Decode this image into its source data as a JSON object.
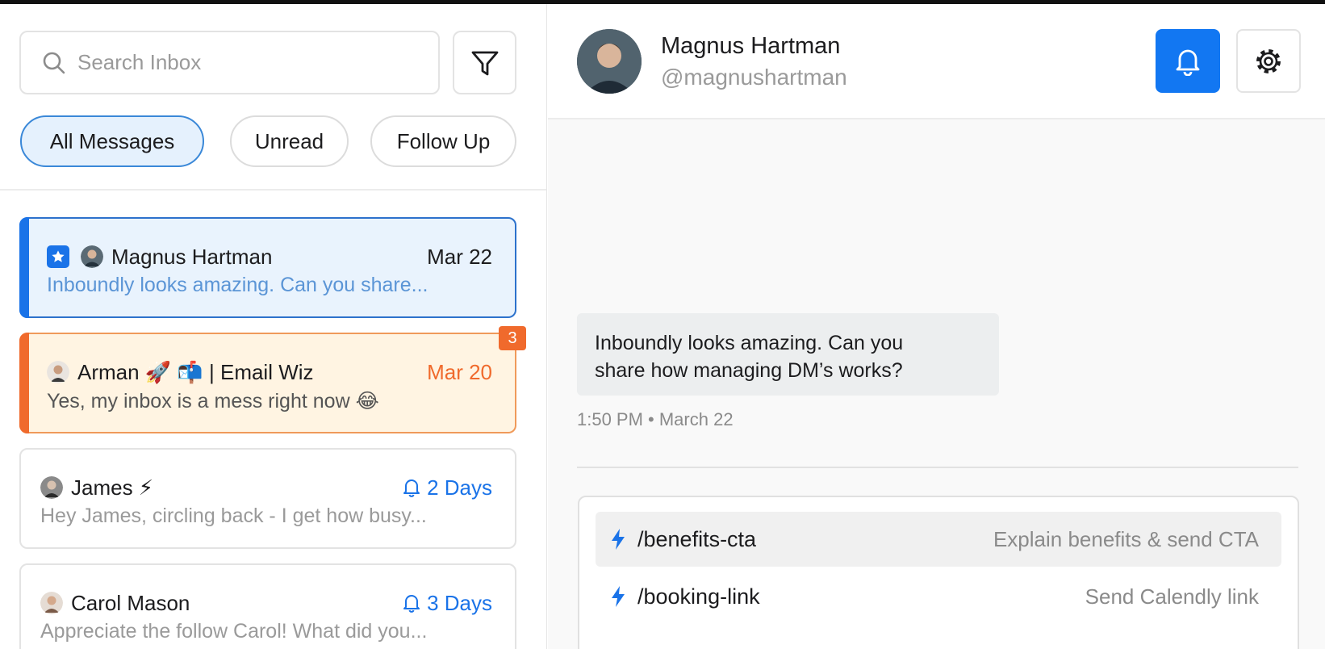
{
  "search": {
    "placeholder": "Search Inbox"
  },
  "filters": [
    {
      "label": "All Messages",
      "active": true
    },
    {
      "label": "Unread",
      "active": false
    },
    {
      "label": "Follow Up",
      "active": false
    }
  ],
  "conversations": [
    {
      "name": "Magnus Hartman",
      "date": "Mar 22",
      "preview": "Inboundly looks amazing. Can you share...",
      "starred": true,
      "accent": "#1a73e8"
    },
    {
      "name": "Arman 🚀 📬  | Email Wiz",
      "date": "Mar 20",
      "preview": "Yes, my inbox is a mess right now 😂",
      "badge": "3",
      "accent": "#f06a2c"
    },
    {
      "name": "James ⚡",
      "date": "2 Days",
      "preview": "Hey James, circling back - I get how busy...",
      "followup_icon": "bell-icon"
    },
    {
      "name": "Carol Mason",
      "date": "3 Days",
      "preview": "Appreciate the follow Carol! What did you...",
      "followup_icon": "bell-icon"
    }
  ],
  "header": {
    "name": "Magnus Hartman",
    "handle": "@magnushartman"
  },
  "message": {
    "lines": [
      "Inboundly looks amazing. Can you",
      "share how managing DM’s works?"
    ],
    "meta": "1:50 PM • March 22"
  },
  "commands": [
    {
      "name": "/benefits-cta",
      "desc": "Explain benefits & send CTA",
      "highlighted": true
    },
    {
      "name": "/booking-link",
      "desc": "Send Calendly link",
      "highlighted": false
    }
  ],
  "colors": {
    "accent_blue": "#1277f2",
    "accent_orange": "#f06a2c",
    "selected_bg": "#e9f3fd",
    "followup_bg": "#fff4e2"
  }
}
